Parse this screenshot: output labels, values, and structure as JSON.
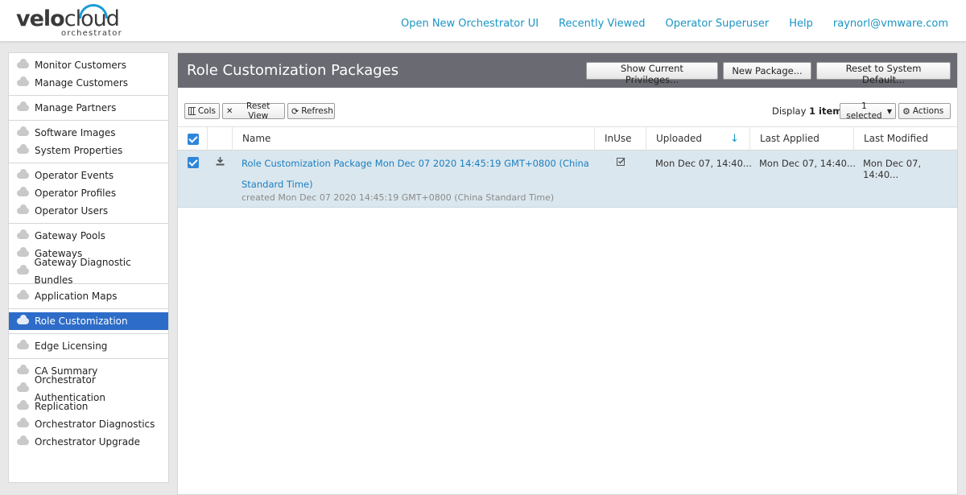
{
  "header": {
    "logo_main_a": "velo",
    "logo_main_b": "cloud",
    "logo_sub": "orchestrator",
    "links": [
      "Open New Orchestrator UI",
      "Recently Viewed",
      "Operator Superuser",
      "Help",
      "raynorl@vmware.com"
    ]
  },
  "sidebar": {
    "groups": [
      [
        "Monitor Customers",
        "Manage Customers"
      ],
      [
        "Manage Partners"
      ],
      [
        "Software Images",
        "System Properties"
      ],
      [
        "Operator Events",
        "Operator Profiles",
        "Operator Users"
      ],
      [
        "Gateway Pools",
        "Gateways",
        "Gateway Diagnostic Bundles"
      ],
      [
        "Application Maps"
      ],
      [
        "Role Customization"
      ],
      [
        "Edge Licensing"
      ],
      [
        "CA Summary",
        "Orchestrator Authentication",
        "Replication",
        "Orchestrator Diagnostics",
        "Orchestrator Upgrade"
      ]
    ],
    "active": "Role Customization"
  },
  "main": {
    "title": "Role Customization Packages",
    "buttons": {
      "show_privileges": "Show Current Privileges...",
      "new_package": "New Package...",
      "reset_default": "Reset to System Default..."
    },
    "toolbar": {
      "cols": "Cols",
      "reset_view": "Reset View",
      "refresh": "Refresh",
      "display_prefix": "Display",
      "display_count": "1 items",
      "selected": "1 selected",
      "actions": "Actions"
    },
    "columns": {
      "name": "Name",
      "inuse": "InUse",
      "uploaded": "Uploaded",
      "last_applied": "Last Applied",
      "last_modified": "Last Modified"
    },
    "rows": [
      {
        "name_line1": "Role Customization Package Mon Dec 07 2020 14:45:19 GMT+0800 (China",
        "name_line2": "Standard Time)",
        "created": "created Mon Dec 07 2020 14:45:19 GMT+0800 (China Standard Time)",
        "uploaded": "Mon Dec 07, 14:40...",
        "last_applied": "Mon Dec 07, 14:40...",
        "last_modified": "Mon Dec 07, 14:40..."
      }
    ]
  },
  "colors": {
    "accent": "#1a95c4",
    "active_nav": "#2d6cc8",
    "titlebar": "#6a6a72",
    "selected_row": "#dbe7ee"
  }
}
